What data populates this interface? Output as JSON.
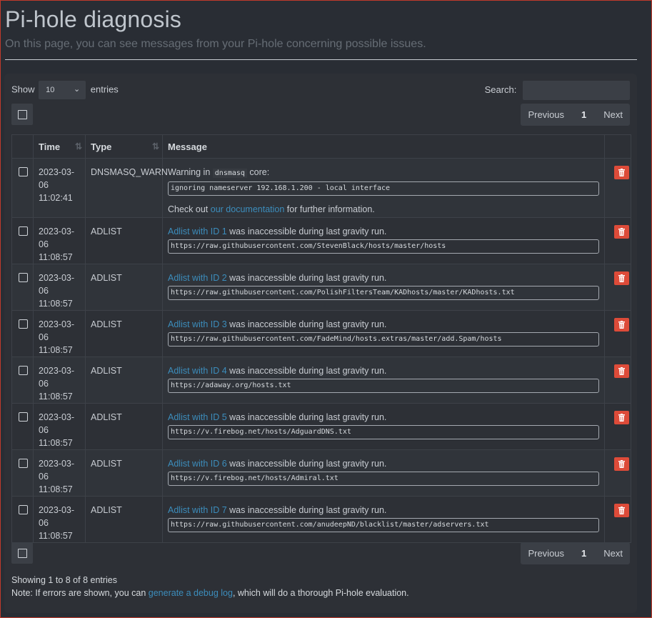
{
  "header": {
    "title": "Pi-hole diagnosis",
    "subtitle": "On this page, you can see messages from your Pi-hole concerning possible issues."
  },
  "controls": {
    "show_label": "Show",
    "entries_value": "10",
    "entries_label": "entries",
    "search_label": "Search:"
  },
  "pagination": {
    "previous": "Previous",
    "current": "1",
    "next": "Next"
  },
  "table": {
    "columns": [
      "Time",
      "Type",
      "Message"
    ],
    "rows": [
      {
        "date": "2023-03-06",
        "time": "11:02:41",
        "type": "DNSMASQ_WARN",
        "msg_prefix": "Warning in",
        "msg_code": "dnsmasq",
        "msg_suffix": "core:",
        "code": "ignoring nameserver 192.168.1.200 - local interface",
        "note_prefix": "Check out",
        "note_link": "our documentation",
        "note_suffix": "for further information."
      },
      {
        "date": "2023-03-06",
        "time": "11:08:57",
        "type": "ADLIST",
        "link": "Adlist with ID 1",
        "text": "was inaccessible during last gravity run.",
        "code": "https://raw.githubusercontent.com/StevenBlack/hosts/master/hosts"
      },
      {
        "date": "2023-03-06",
        "time": "11:08:57",
        "type": "ADLIST",
        "link": "Adlist with ID 2",
        "text": "was inaccessible during last gravity run.",
        "code": "https://raw.githubusercontent.com/PolishFiltersTeam/KADhosts/master/KADhosts.txt"
      },
      {
        "date": "2023-03-06",
        "time": "11:08:57",
        "type": "ADLIST",
        "link": "Adlist with ID 3",
        "text": "was inaccessible during last gravity run.",
        "code": "https://raw.githubusercontent.com/FadeMind/hosts.extras/master/add.Spam/hosts"
      },
      {
        "date": "2023-03-06",
        "time": "11:08:57",
        "type": "ADLIST",
        "link": "Adlist with ID 4",
        "text": "was inaccessible during last gravity run.",
        "code": "https://adaway.org/hosts.txt"
      },
      {
        "date": "2023-03-06",
        "time": "11:08:57",
        "type": "ADLIST",
        "link": "Adlist with ID 5",
        "text": "was inaccessible during last gravity run.",
        "code": "https://v.firebog.net/hosts/AdguardDNS.txt"
      },
      {
        "date": "2023-03-06",
        "time": "11:08:57",
        "type": "ADLIST",
        "link": "Adlist with ID 6",
        "text": "was inaccessible during last gravity run.",
        "code": "https://v.firebog.net/hosts/Admiral.txt"
      },
      {
        "date": "2023-03-06",
        "time": "11:08:57",
        "type": "ADLIST",
        "link": "Adlist with ID 7",
        "text": "was inaccessible during last gravity run.",
        "code": "https://raw.githubusercontent.com/anudeepND/blacklist/master/adservers.txt"
      }
    ]
  },
  "footer": {
    "showing": "Showing 1 to 8 of 8 entries",
    "note_prefix": "Note: If errors are shown, you can",
    "note_link": "generate a debug log",
    "note_suffix": ", which will do a thorough Pi-hole evaluation."
  },
  "colors": {
    "danger": "#dd4b39",
    "link": "#3c8dbc",
    "background": "#292d34"
  }
}
